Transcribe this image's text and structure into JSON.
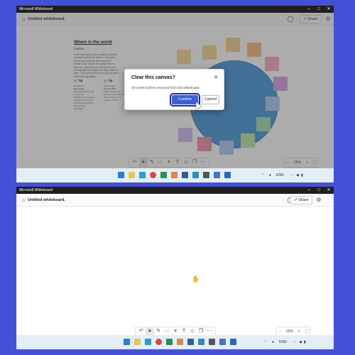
{
  "window": {
    "app_title": "Microsoft Whiteboard",
    "doc_title": "Untitled whiteboard",
    "share_label": "Share",
    "controls": {
      "minimize": "–",
      "maximize": "□",
      "close": "✕"
    }
  },
  "canvas_content": {
    "heading": "Where in the world",
    "subheading": "Games",
    "paragraph": "At the beginning of your meeting, someone (in what location) ask users to note down where they take back and everyone's location map on that. Encourage them to show the whiteboard (if a few see the you can highlight the answers on sticky notes for them. This works well for small groups than it of the opening activity.",
    "tip1": {
      "label": "Tip",
      "lines": [
        "Navigation",
        "Next letter",
        "Selecting objects can be key the Whiteboard service by clicking and the key shortcuts which have the best the expanded."
      ]
    },
    "tip2": {
      "label": "Tip",
      "lines": [
        "Select object",
        "Use the Pen",
        "Click to select an activity to edit the item and a number to a number of them."
      ]
    }
  },
  "dialog": {
    "title": "Clear this canvas?",
    "message": "All content will be removed from this whiteboard.",
    "confirm_label": "Confirm",
    "cancel_label": "Cancel",
    "close_icon": "✕"
  },
  "toolbar": {
    "tools": [
      "undo-icon",
      "select-icon",
      "pen-icon",
      "note-icon",
      "reaction-icon",
      "text-icon",
      "shapes-icon",
      "copy-icon",
      "more-icon"
    ],
    "glyphs": [
      "↶",
      "➤",
      "✎",
      "▭",
      "♥",
      "T",
      "◇",
      "❐",
      "⋯"
    ]
  },
  "zoom": {
    "zoom_out": "−",
    "level": "15%",
    "zoom_in": "+",
    "fit": "⛶"
  },
  "taskbar": {
    "language": "ENG",
    "tray_icons": [
      "chevron-up-icon",
      "mic-icon",
      "wifi-icon",
      "volume-icon",
      "battery-icon"
    ]
  },
  "colors": {
    "background": "#4450d6",
    "accent": "#3f5fd8",
    "circle": "#3f94db",
    "sticky_notes": [
      "#f6c98a",
      "#f7d38a",
      "#f9b46f",
      "#f7a6c2",
      "#f08aa6",
      "#d59ae6",
      "#a8c9f2",
      "#9fd9b0",
      "#bfe6a1",
      "#d0b6ef"
    ]
  }
}
